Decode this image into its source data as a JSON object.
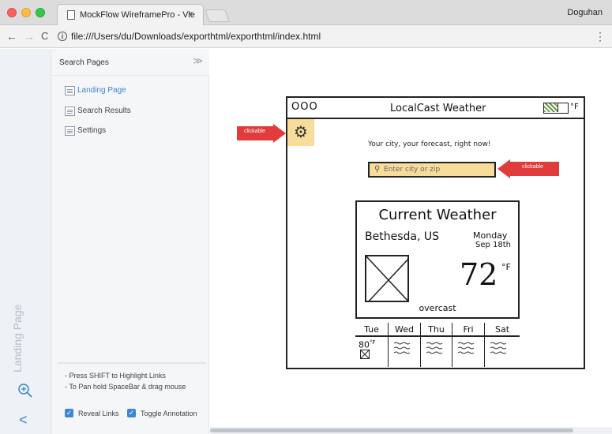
{
  "browser": {
    "tab_title": "MockFlow WireframePro - Vie",
    "tab_close": "×",
    "profile": "Doguhan",
    "url": "file:///Users/du/Downloads/exporthtml/exporthtml/index.html",
    "back_icon": "←",
    "forward_icon": "→",
    "reload_icon": "C",
    "info_icon": "i",
    "menu_icon": "⋮"
  },
  "rail": {
    "label": "Landing Page",
    "collapse_icon": "<"
  },
  "pages": {
    "search_label": "Search Pages",
    "collapse_icon": "≫",
    "items": [
      {
        "label": "Landing Page",
        "active": true
      },
      {
        "label": "Search Results",
        "active": false
      },
      {
        "label": "Settings",
        "active": false
      }
    ],
    "hints": [
      "- Press SHIFT to Highlight Links",
      "- To Pan hold SpaceBar & drag mouse"
    ],
    "reveal_links": "Reveal Links",
    "toggle_annotation": "Toggle Annotation",
    "check_mark": "✓"
  },
  "wireframe": {
    "dots": "OOO",
    "app_title": "LocalCast Weather",
    "unit_toggle": "°F",
    "gear_icon": "⚙",
    "tagline": "Your city, your forecast, right now!",
    "search_icon": "⚲",
    "search_placeholder": "Enter city or zip",
    "card_title": "Current Weather",
    "city": "Bethesda, US",
    "day": "Monday",
    "date": "Sep 18th",
    "temperature": "72",
    "temp_unit": "°F",
    "condition": "overcast",
    "forecast_days": [
      "Tue",
      "Wed",
      "Thu",
      "Fri",
      "Sat"
    ],
    "forecast_first_temp": "80",
    "forecast_first_unit": "°F"
  },
  "annotations": {
    "gear_arrow": "clickable",
    "search_arrow": "clickable"
  },
  "colors": {
    "accent": "#3b86d6",
    "annotation": "#e23b3b",
    "highlight": "#f8dc9a"
  }
}
